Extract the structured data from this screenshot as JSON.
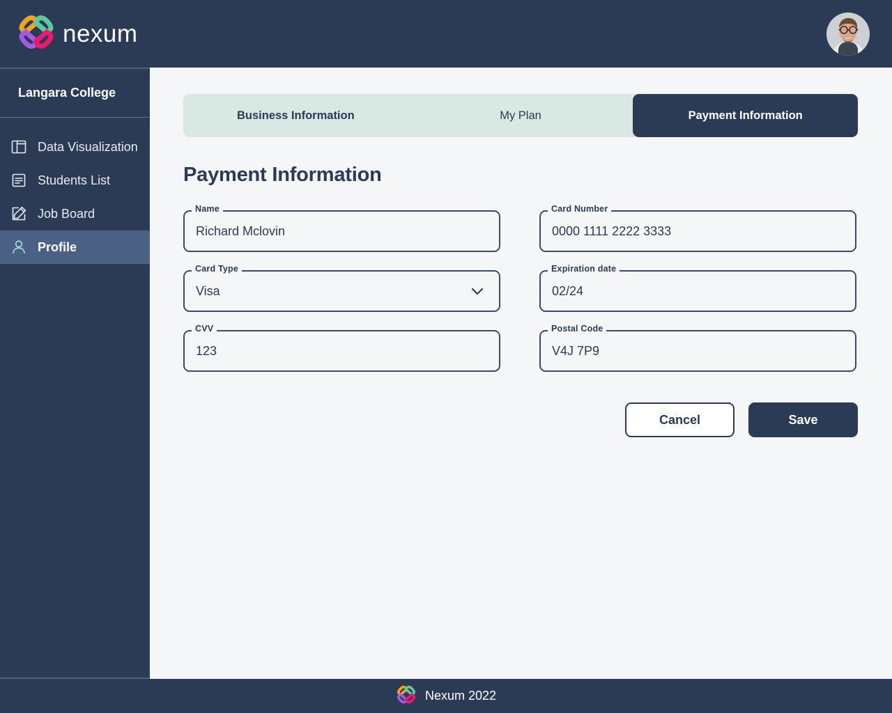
{
  "header": {
    "brand_name": "nexum",
    "logo_icon": "nexum-chain-logo",
    "avatar_icon": "user-avatar-photo",
    "colors": {
      "navy": "#2b3a55",
      "logo_orange": "#f2a51a",
      "logo_green": "#5ec9a0",
      "logo_purple": "#a55ae0",
      "logo_pink": "#ec1a6e"
    }
  },
  "sidebar": {
    "org_name": "Langara College",
    "items": [
      {
        "label": "Data Visualization",
        "icon": "layout-panel-icon",
        "active": false
      },
      {
        "label": "Students List",
        "icon": "document-lines-icon",
        "active": false
      },
      {
        "label": "Job Board",
        "icon": "pencil-square-icon",
        "active": false
      },
      {
        "label": "Profile",
        "icon": "person-icon",
        "active": true
      }
    ]
  },
  "main": {
    "tabs": [
      {
        "label": "Business Information",
        "active": false,
        "bold": true
      },
      {
        "label": "My Plan",
        "active": false,
        "bold": false
      },
      {
        "label": "Payment Information",
        "active": true,
        "bold": true
      }
    ],
    "page_title": "Payment Information",
    "fields": {
      "name": {
        "label": "Name",
        "value": "Richard Mclovin"
      },
      "card_number": {
        "label": "Card Number",
        "value": "0000 1111 2222 3333"
      },
      "card_type": {
        "label": "Card Type",
        "value": "Visa",
        "icon": "chevron-down-icon"
      },
      "expiration_date": {
        "label": "Expiration date",
        "value": "02/24"
      },
      "cvv": {
        "label": "CVV",
        "value": "123"
      },
      "postal_code": {
        "label": "Postal Code",
        "value": "V4J 7P9"
      }
    },
    "buttons": {
      "cancel": "Cancel",
      "save": "Save"
    }
  },
  "footer": {
    "text": "Nexum 2022",
    "logo_icon": "nexum-chain-logo"
  }
}
